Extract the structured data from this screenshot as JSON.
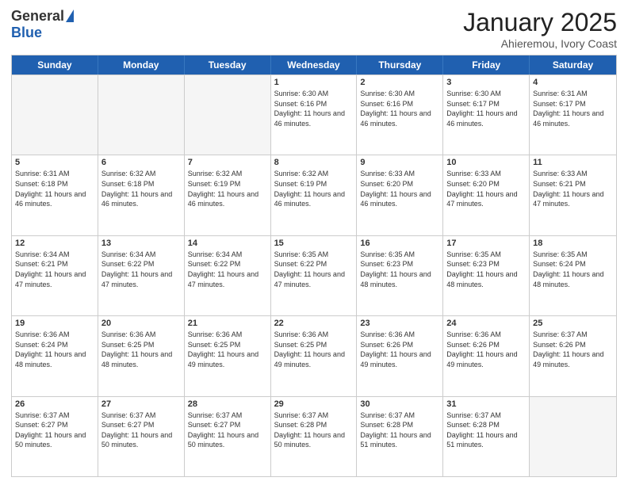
{
  "logo": {
    "general": "General",
    "blue": "Blue"
  },
  "title": "January 2025",
  "subtitle": "Ahieremou, Ivory Coast",
  "headers": [
    "Sunday",
    "Monday",
    "Tuesday",
    "Wednesday",
    "Thursday",
    "Friday",
    "Saturday"
  ],
  "weeks": [
    [
      {
        "day": "",
        "info": "",
        "empty": true
      },
      {
        "day": "",
        "info": "",
        "empty": true
      },
      {
        "day": "",
        "info": "",
        "empty": true
      },
      {
        "day": "1",
        "info": "Sunrise: 6:30 AM\nSunset: 6:16 PM\nDaylight: 11 hours\nand 46 minutes.",
        "empty": false
      },
      {
        "day": "2",
        "info": "Sunrise: 6:30 AM\nSunset: 6:16 PM\nDaylight: 11 hours\nand 46 minutes.",
        "empty": false
      },
      {
        "day": "3",
        "info": "Sunrise: 6:30 AM\nSunset: 6:17 PM\nDaylight: 11 hours\nand 46 minutes.",
        "empty": false
      },
      {
        "day": "4",
        "info": "Sunrise: 6:31 AM\nSunset: 6:17 PM\nDaylight: 11 hours\nand 46 minutes.",
        "empty": false
      }
    ],
    [
      {
        "day": "5",
        "info": "Sunrise: 6:31 AM\nSunset: 6:18 PM\nDaylight: 11 hours\nand 46 minutes.",
        "empty": false
      },
      {
        "day": "6",
        "info": "Sunrise: 6:32 AM\nSunset: 6:18 PM\nDaylight: 11 hours\nand 46 minutes.",
        "empty": false
      },
      {
        "day": "7",
        "info": "Sunrise: 6:32 AM\nSunset: 6:19 PM\nDaylight: 11 hours\nand 46 minutes.",
        "empty": false
      },
      {
        "day": "8",
        "info": "Sunrise: 6:32 AM\nSunset: 6:19 PM\nDaylight: 11 hours\nand 46 minutes.",
        "empty": false
      },
      {
        "day": "9",
        "info": "Sunrise: 6:33 AM\nSunset: 6:20 PM\nDaylight: 11 hours\nand 46 minutes.",
        "empty": false
      },
      {
        "day": "10",
        "info": "Sunrise: 6:33 AM\nSunset: 6:20 PM\nDaylight: 11 hours\nand 47 minutes.",
        "empty": false
      },
      {
        "day": "11",
        "info": "Sunrise: 6:33 AM\nSunset: 6:21 PM\nDaylight: 11 hours\nand 47 minutes.",
        "empty": false
      }
    ],
    [
      {
        "day": "12",
        "info": "Sunrise: 6:34 AM\nSunset: 6:21 PM\nDaylight: 11 hours\nand 47 minutes.",
        "empty": false
      },
      {
        "day": "13",
        "info": "Sunrise: 6:34 AM\nSunset: 6:22 PM\nDaylight: 11 hours\nand 47 minutes.",
        "empty": false
      },
      {
        "day": "14",
        "info": "Sunrise: 6:34 AM\nSunset: 6:22 PM\nDaylight: 11 hours\nand 47 minutes.",
        "empty": false
      },
      {
        "day": "15",
        "info": "Sunrise: 6:35 AM\nSunset: 6:22 PM\nDaylight: 11 hours\nand 47 minutes.",
        "empty": false
      },
      {
        "day": "16",
        "info": "Sunrise: 6:35 AM\nSunset: 6:23 PM\nDaylight: 11 hours\nand 48 minutes.",
        "empty": false
      },
      {
        "day": "17",
        "info": "Sunrise: 6:35 AM\nSunset: 6:23 PM\nDaylight: 11 hours\nand 48 minutes.",
        "empty": false
      },
      {
        "day": "18",
        "info": "Sunrise: 6:35 AM\nSunset: 6:24 PM\nDaylight: 11 hours\nand 48 minutes.",
        "empty": false
      }
    ],
    [
      {
        "day": "19",
        "info": "Sunrise: 6:36 AM\nSunset: 6:24 PM\nDaylight: 11 hours\nand 48 minutes.",
        "empty": false
      },
      {
        "day": "20",
        "info": "Sunrise: 6:36 AM\nSunset: 6:25 PM\nDaylight: 11 hours\nand 48 minutes.",
        "empty": false
      },
      {
        "day": "21",
        "info": "Sunrise: 6:36 AM\nSunset: 6:25 PM\nDaylight: 11 hours\nand 49 minutes.",
        "empty": false
      },
      {
        "day": "22",
        "info": "Sunrise: 6:36 AM\nSunset: 6:25 PM\nDaylight: 11 hours\nand 49 minutes.",
        "empty": false
      },
      {
        "day": "23",
        "info": "Sunrise: 6:36 AM\nSunset: 6:26 PM\nDaylight: 11 hours\nand 49 minutes.",
        "empty": false
      },
      {
        "day": "24",
        "info": "Sunrise: 6:36 AM\nSunset: 6:26 PM\nDaylight: 11 hours\nand 49 minutes.",
        "empty": false
      },
      {
        "day": "25",
        "info": "Sunrise: 6:37 AM\nSunset: 6:26 PM\nDaylight: 11 hours\nand 49 minutes.",
        "empty": false
      }
    ],
    [
      {
        "day": "26",
        "info": "Sunrise: 6:37 AM\nSunset: 6:27 PM\nDaylight: 11 hours\nand 50 minutes.",
        "empty": false
      },
      {
        "day": "27",
        "info": "Sunrise: 6:37 AM\nSunset: 6:27 PM\nDaylight: 11 hours\nand 50 minutes.",
        "empty": false
      },
      {
        "day": "28",
        "info": "Sunrise: 6:37 AM\nSunset: 6:27 PM\nDaylight: 11 hours\nand 50 minutes.",
        "empty": false
      },
      {
        "day": "29",
        "info": "Sunrise: 6:37 AM\nSunset: 6:28 PM\nDaylight: 11 hours\nand 50 minutes.",
        "empty": false
      },
      {
        "day": "30",
        "info": "Sunrise: 6:37 AM\nSunset: 6:28 PM\nDaylight: 11 hours\nand 51 minutes.",
        "empty": false
      },
      {
        "day": "31",
        "info": "Sunrise: 6:37 AM\nSunset: 6:28 PM\nDaylight: 11 hours\nand 51 minutes.",
        "empty": false
      },
      {
        "day": "",
        "info": "",
        "empty": true
      }
    ]
  ]
}
